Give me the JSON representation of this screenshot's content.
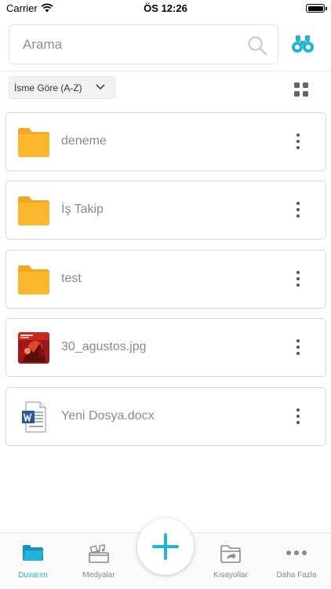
{
  "status_bar": {
    "carrier": "Carrier",
    "time": "ÖS 12:26"
  },
  "search": {
    "placeholder": "Arama",
    "value": ""
  },
  "sort": {
    "selected": "İsme Göre (A-Z)"
  },
  "files": [
    {
      "name": "deneme",
      "type": "folder"
    },
    {
      "name": "İş Takip",
      "type": "folder"
    },
    {
      "name": "test",
      "type": "folder"
    },
    {
      "name": "30_agustos.jpg",
      "type": "image"
    },
    {
      "name": "Yeni Dosya.docx",
      "type": "docx"
    }
  ],
  "tabs": [
    {
      "label": "Duvarım",
      "icon": "folder-icon",
      "active": true
    },
    {
      "label": "Medyalar",
      "icon": "media-icon",
      "active": false
    },
    {
      "label": "Kısayollar",
      "icon": "shortcut-folder-icon",
      "active": false
    },
    {
      "label": "Daha Fazla",
      "icon": "more-horizontal-icon",
      "active": false
    }
  ],
  "colors": {
    "accent": "#21b4d6",
    "folder": "#fbb82c",
    "text_muted": "#8a8a8a"
  }
}
